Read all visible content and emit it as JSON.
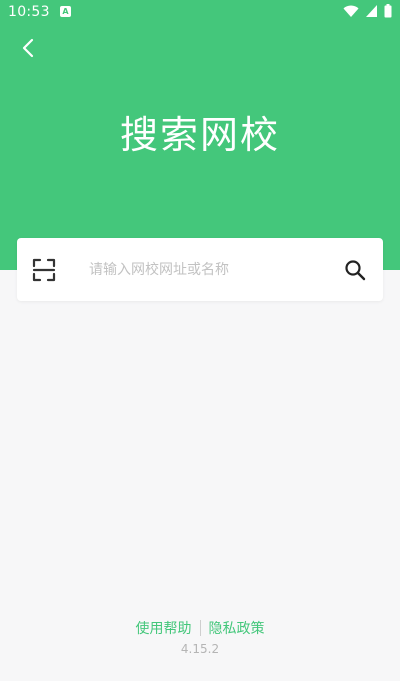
{
  "status_bar": {
    "time": "10:53",
    "notification_letter": "A"
  },
  "header": {
    "title": "搜索网校"
  },
  "search": {
    "placeholder": "请输入网校网址或名称"
  },
  "footer": {
    "help_label": "使用帮助",
    "privacy_label": "隐私政策",
    "version": "4.15.2"
  },
  "colors": {
    "accent": "#44c77b",
    "background": "#f7f7f8",
    "placeholder": "#c2c2c2",
    "version_text": "#b5b5b5"
  },
  "icons": [
    "back-icon",
    "scan-icon",
    "search-icon",
    "wifi-icon",
    "signal-icon",
    "battery-icon"
  ]
}
